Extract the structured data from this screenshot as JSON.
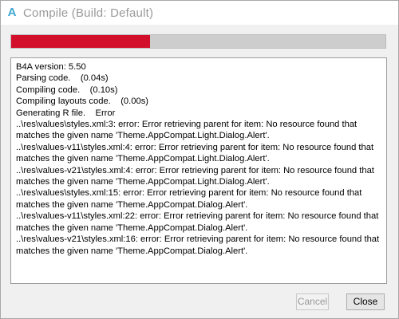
{
  "window": {
    "title": "Compile (Build: Default)",
    "app_icon": "A"
  },
  "progress": {
    "fraction": 0.37,
    "color": "#d2102c"
  },
  "log": {
    "lines": [
      "B4A version: 5.50",
      "Parsing code.    (0.04s)",
      "Compiling code.    (0.10s)",
      "Compiling layouts code.    (0.00s)",
      "Generating R file.    Error",
      "..\\res\\values\\styles.xml:3: error: Error retrieving parent for item: No resource found that matches the given name 'Theme.AppCompat.Light.Dialog.Alert'.",
      "..\\res\\values-v11\\styles.xml:4: error: Error retrieving parent for item: No resource found that matches the given name 'Theme.AppCompat.Light.Dialog.Alert'.",
      "..\\res\\values-v21\\styles.xml:4: error: Error retrieving parent for item: No resource found that matches the given name 'Theme.AppCompat.Light.Dialog.Alert'.",
      "..\\res\\values\\styles.xml:15: error: Error retrieving parent for item: No resource found that matches the given name 'Theme.AppCompat.Dialog.Alert'.",
      "..\\res\\values-v11\\styles.xml:22: error: Error retrieving parent for item: No resource found that matches the given name 'Theme.AppCompat.Dialog.Alert'.",
      "..\\res\\values-v21\\styles.xml:16: error: Error retrieving parent for item: No resource found that matches the given name 'Theme.AppCompat.Dialog.Alert'."
    ]
  },
  "buttons": {
    "cancel_label": "Cancel",
    "close_label": "Close"
  }
}
